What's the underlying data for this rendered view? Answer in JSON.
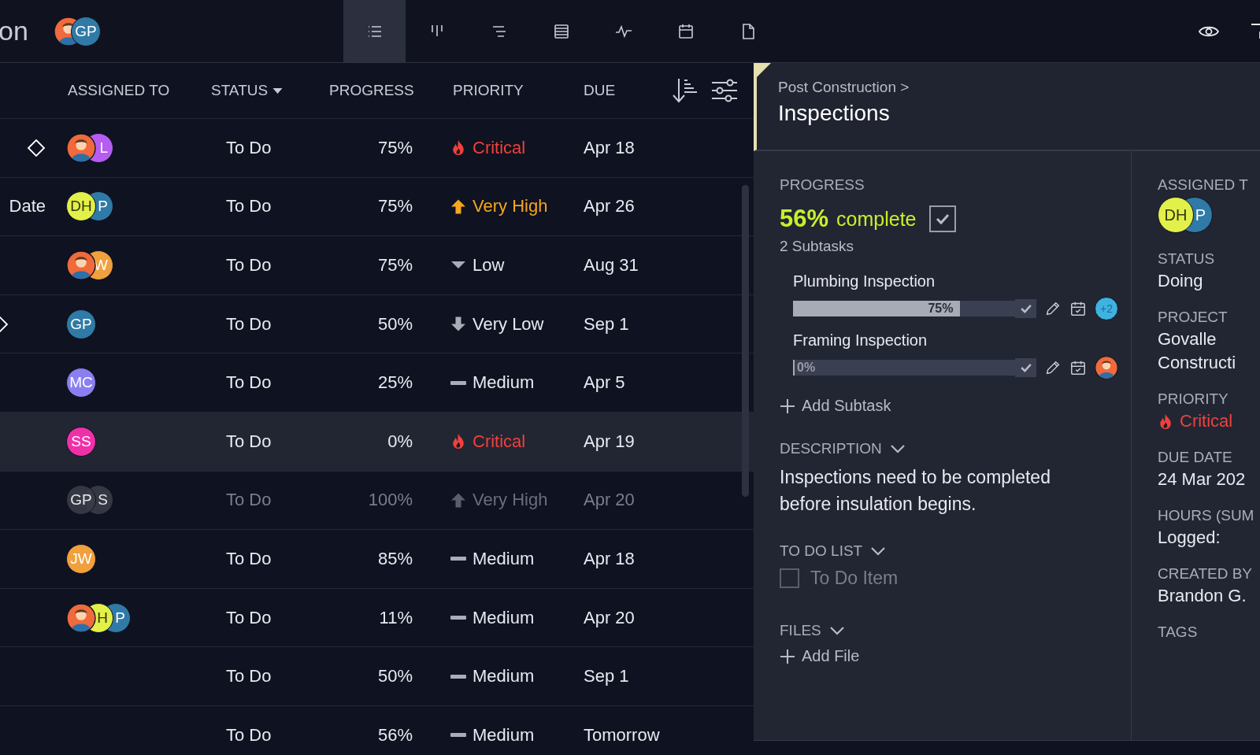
{
  "topbar": {
    "title": "on",
    "avatars": [
      {
        "kind": "photo",
        "color": "#f06a3c"
      },
      {
        "kind": "initials",
        "text": "GP",
        "color": "#2f7aa6"
      }
    ],
    "views": [
      {
        "kind": "list",
        "selected": true
      },
      {
        "kind": "board",
        "selected": false
      },
      {
        "kind": "gantt",
        "selected": false
      },
      {
        "kind": "sheet",
        "selected": false
      },
      {
        "kind": "dashboard",
        "selected": false
      },
      {
        "kind": "calendar",
        "selected": false
      },
      {
        "kind": "doc",
        "selected": false
      }
    ]
  },
  "table": {
    "columns": [
      {
        "label": "ASSIGNED TO",
        "sortable": false
      },
      {
        "label": "STATUS",
        "sortable": true
      },
      {
        "label": "PROGRESS",
        "sortable": false
      },
      {
        "label": "PRIORITY",
        "sortable": false
      },
      {
        "label": "DUE",
        "sortable": false
      }
    ],
    "rows": [
      {
        "milestone": true,
        "selected": false,
        "done": false,
        "avatars": [
          {
            "kind": "photo",
            "color": "#f06a3c"
          },
          {
            "kind": "initials",
            "text": "L",
            "color": "#b65cf0"
          }
        ],
        "status": "To Do",
        "progress": "75%",
        "priority": {
          "kind": "critical",
          "label": "Critical"
        },
        "due": "Apr 18"
      },
      {
        "name": "Date",
        "milestone": false,
        "selected": false,
        "done": false,
        "avatars": [
          {
            "kind": "initials",
            "text": "DH",
            "color": "#e2f04a"
          },
          {
            "kind": "initials",
            "text": "P",
            "color": "#2f7aa6"
          }
        ],
        "status": "To Do",
        "progress": "75%",
        "priority": {
          "kind": "very_high",
          "label": "Very High"
        },
        "due": "Apr 26"
      },
      {
        "milestone": false,
        "selected": false,
        "done": false,
        "avatars": [
          {
            "kind": "photo",
            "color": "#f06a3c"
          },
          {
            "kind": "initials",
            "text": "W",
            "color": "#f0a03c"
          }
        ],
        "status": "To Do",
        "progress": "75%",
        "priority": {
          "kind": "low",
          "label": "Low"
        },
        "due": "Aug 31"
      },
      {
        "milestone": true,
        "selected": false,
        "done": false,
        "avatars": [
          {
            "kind": "initials",
            "text": "GP",
            "color": "#2f7aa6"
          }
        ],
        "status": "To Do",
        "progress": "50%",
        "priority": {
          "kind": "very_low",
          "label": "Very Low"
        },
        "due": "Sep 1"
      },
      {
        "milestone": false,
        "selected": false,
        "done": false,
        "avatars": [
          {
            "kind": "initials",
            "text": "MC",
            "color": "#8a7ff0"
          }
        ],
        "status": "To Do",
        "progress": "25%",
        "priority": {
          "kind": "medium",
          "label": "Medium"
        },
        "due": "Apr 5"
      },
      {
        "milestone": false,
        "selected": true,
        "done": false,
        "avatars": [
          {
            "kind": "initials",
            "text": "SS",
            "color": "#f030a8"
          }
        ],
        "status": "To Do",
        "progress": "0%",
        "priority": {
          "kind": "critical",
          "label": "Critical"
        },
        "due": "Apr 19"
      },
      {
        "milestone": false,
        "selected": false,
        "done": true,
        "avatars": [
          {
            "kind": "initials",
            "text": "GP",
            "color": "#3a3d48"
          },
          {
            "kind": "initials",
            "text": "S",
            "color": "#3a3d48"
          }
        ],
        "status": "To Do",
        "progress": "100%",
        "priority": {
          "kind": "very_high",
          "label": "Very High"
        },
        "due": "Apr 20"
      },
      {
        "milestone": false,
        "selected": false,
        "done": false,
        "avatars": [
          {
            "kind": "initials",
            "text": "JW",
            "color": "#f0a03c"
          }
        ],
        "status": "To Do",
        "progress": "85%",
        "priority": {
          "kind": "medium",
          "label": "Medium"
        },
        "due": "Apr 18"
      },
      {
        "milestone": false,
        "selected": false,
        "done": false,
        "avatars": [
          {
            "kind": "photo",
            "color": "#f06a3c"
          },
          {
            "kind": "initials",
            "text": "H",
            "color": "#e2f04a"
          },
          {
            "kind": "initials",
            "text": "P",
            "color": "#2f7aa6"
          }
        ],
        "status": "To Do",
        "progress": "11%",
        "priority": {
          "kind": "medium",
          "label": "Medium"
        },
        "due": "Apr 20"
      },
      {
        "milestone": false,
        "selected": false,
        "done": false,
        "status": "To Do",
        "progress": "50%",
        "priority": {
          "kind": "medium",
          "label": "Medium"
        },
        "due": "Sep 1"
      },
      {
        "milestone": false,
        "selected": false,
        "done": false,
        "status": "To Do",
        "progress": "56%",
        "priority": {
          "kind": "medium",
          "label": "Medium"
        },
        "due": "Tomorrow"
      }
    ]
  },
  "detail": {
    "breadcrumb": "Post Construction >",
    "title": "Inspections",
    "progress": {
      "label": "PROGRESS",
      "percent": "56%",
      "suffix": "complete",
      "checked": true,
      "subtask_count": "2 Subtasks"
    },
    "subtasks": [
      {
        "name": "Plumbing Inspection",
        "level": 0.75,
        "reading": "75%",
        "assignee": {
          "kind": "count",
          "text": "+2",
          "color": "#3fb2e0"
        }
      },
      {
        "name": "Framing Inspection",
        "level": 0,
        "reading": "0%",
        "assignee": {
          "kind": "photo",
          "color": "#f06a3c"
        }
      }
    ],
    "add_subtask": "Add Subtask",
    "description": {
      "label": "DESCRIPTION",
      "text": "Inspections need to be completed before insulation begins."
    },
    "todo": {
      "label": "TO DO LIST",
      "items": [
        {
          "placeholder": "To Do Item",
          "checked": false
        }
      ]
    },
    "files": {
      "label": "FILES",
      "add": "Add File"
    },
    "fields": [
      {
        "label": "ASSIGNED T",
        "kind": "avatars",
        "avatars": [
          {
            "kind": "initials",
            "text": "DH",
            "color": "#e2f04a"
          },
          {
            "kind": "initials",
            "text": "P",
            "color": "#2f7aa6"
          }
        ]
      },
      {
        "label": "STATUS",
        "kind": "text",
        "lines": [
          "Doing"
        ]
      },
      {
        "label": "PROJECT",
        "kind": "text",
        "lines": [
          "Govalle",
          "Constructi"
        ]
      },
      {
        "label": "PRIORITY",
        "kind": "priority",
        "priority": {
          "kind": "critical",
          "label": "Critical"
        }
      },
      {
        "label": "DUE DATE",
        "kind": "text",
        "lines": [
          "24 Mar 202"
        ]
      },
      {
        "label": "HOURS (SUM",
        "kind": "text",
        "lines": [
          "Logged:"
        ]
      },
      {
        "label": "CREATED BY",
        "kind": "text",
        "lines": [
          "Brandon G."
        ]
      },
      {
        "label": "TAGS",
        "kind": "empty"
      }
    ]
  }
}
